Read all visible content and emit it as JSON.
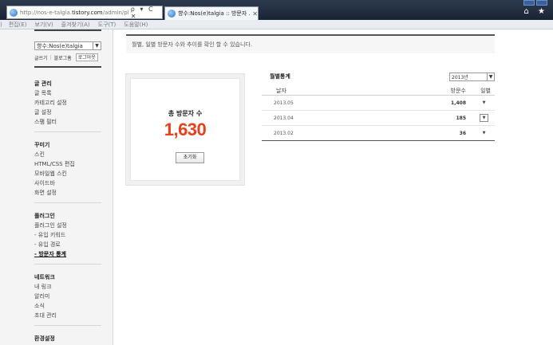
{
  "browser": {
    "address": {
      "domain_prefix": "http://nos-e-talgia.",
      "domain": "tistory.com",
      "path": "/admin/plug",
      "controls": "ρ ▾ C ✕"
    },
    "tab": {
      "title": "향수:Nos(e)talgia :: 방문자 ...",
      "close": "✕"
    },
    "toolbar_icons": "⌂ ★",
    "menu": [
      "편집(E)",
      "보기(V)",
      "즐겨찾기(A)",
      "도구(T)",
      "도움말(H)"
    ],
    "menu_partial": ")"
  },
  "sidebar": {
    "blog_select": "향수:Nos(e)talgia",
    "links": {
      "write": "글쓰기",
      "blog_home": "블로그홈",
      "logout": "로그아웃"
    },
    "sections": [
      {
        "title": "글 관리",
        "items": [
          "글 목록",
          "카테고리 설정",
          "글 설정",
          "스팸 필터"
        ]
      },
      {
        "title": "꾸미기",
        "items": [
          "스킨",
          "HTML/CSS 편집",
          "모바일웹 스킨",
          "사이드바",
          "화면 설정"
        ]
      },
      {
        "title": "플러그인",
        "items": [
          "플러그인 설정",
          "- 유입 키워드",
          "- 유입 경로",
          "- 방문자 통계"
        ]
      },
      {
        "title": "네트워크",
        "items": [
          "내 링크",
          "알리미",
          "소식",
          "초대 관리"
        ]
      },
      {
        "title": "환경설정",
        "items": []
      }
    ],
    "active_item": "- 방문자 통계"
  },
  "main": {
    "description": "월별, 일별 방문자 수와 추이를 확인 할 수 있습니다.",
    "total": {
      "label": "총 방문자 수",
      "value": "1,630",
      "reset_label": "초기화",
      "value_color": "#e8401c"
    },
    "stats": {
      "title": "월별통계",
      "year_select": "2013년",
      "columns": {
        "date": "날자",
        "visitors": "방문수",
        "daily": "일별"
      },
      "rows": [
        {
          "date": "2013.05",
          "visitors": "1,408"
        },
        {
          "date": "2013.04",
          "visitors": "185"
        },
        {
          "date": "2013.02",
          "visitors": "36"
        }
      ]
    }
  }
}
